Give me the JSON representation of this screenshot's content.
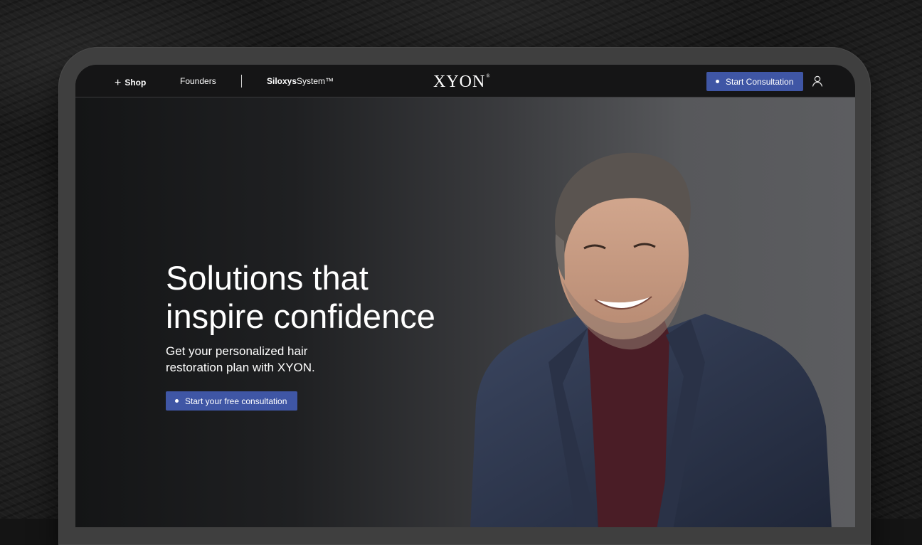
{
  "nav": {
    "shop_label": "Shop",
    "founders_label": "Founders",
    "siloxys_bold": "Siloxys",
    "siloxys_rest": "System™",
    "logo": "XYON",
    "logo_mark": "®",
    "cta_label": "Start Consultation"
  },
  "hero": {
    "headline_line1": "Solutions that",
    "headline_line2": "inspire confidence",
    "sub_line1": "Get your personalized hair",
    "sub_line2": "restoration plan with XYON.",
    "cta_label": "Start your free consultation"
  },
  "colors": {
    "accent": "#3f56a5",
    "nav_bg": "#151516",
    "text": "#ffffff"
  },
  "icons": {
    "shop": "plus-icon",
    "user": "user-icon"
  }
}
